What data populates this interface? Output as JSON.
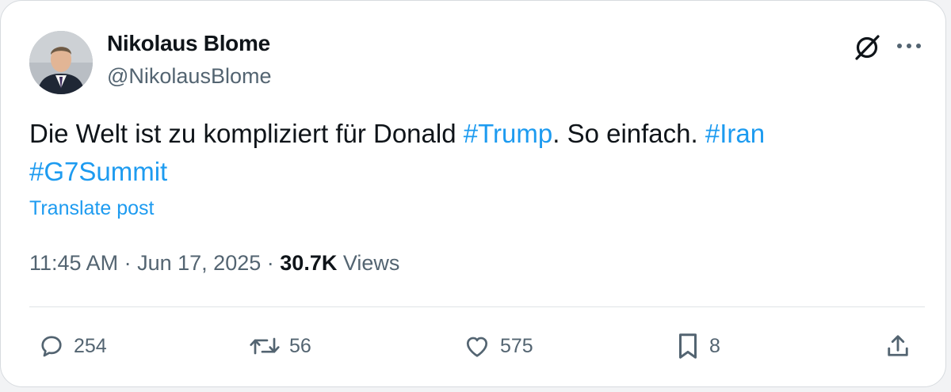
{
  "author": {
    "name": "Nikolaus Blome",
    "handle": "@NikolausBlome"
  },
  "post": {
    "text_before": "Die Welt ist zu kompliziert für Donald ",
    "hashtag_trump": "#Trump",
    "text_middle": ". So einfach. ",
    "hashtag_iran": "#Iran",
    "hashtag_g7": "#G7Summit",
    "translate_label": "Translate post"
  },
  "meta": {
    "time": "11:45 AM",
    "separator": "·",
    "date": "Jun 17, 2025",
    "views_count": "30.7K",
    "views_label": "Views"
  },
  "actions": {
    "replies": "254",
    "reposts": "56",
    "likes": "575",
    "bookmarks": "8"
  },
  "icons": {
    "header": [
      "grok-icon",
      "more-icon"
    ],
    "actions": [
      "reply-icon",
      "repost-icon",
      "like-icon",
      "bookmark-icon",
      "share-icon"
    ]
  },
  "colors": {
    "text": "#0f1419",
    "secondary": "#536471",
    "link": "#1d9bf0",
    "divider": "#dfe3e6"
  }
}
